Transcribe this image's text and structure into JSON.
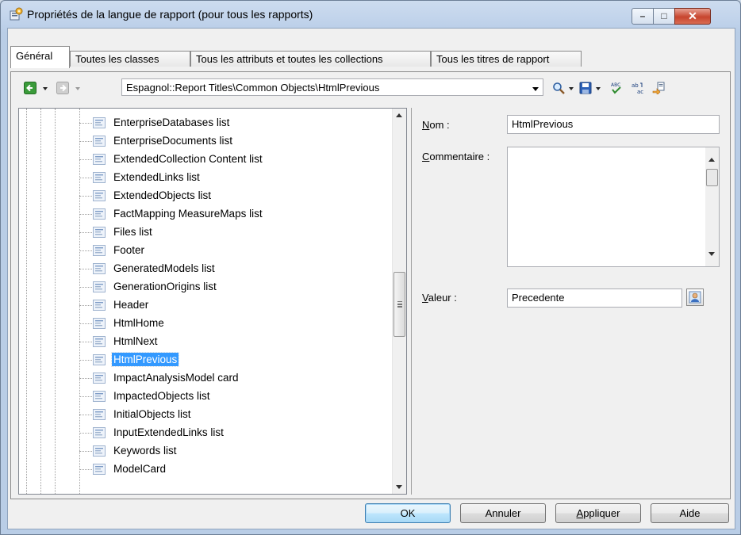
{
  "window": {
    "title": "Propriétés de la langue de rapport (pour tous les rapports)",
    "controls": {
      "minimize": "–",
      "maximize": "□",
      "close": "✕"
    }
  },
  "tabs": [
    {
      "label": "Général"
    },
    {
      "label": "Toutes les classes"
    },
    {
      "label": "Tous les attributs et toutes les collections"
    },
    {
      "label": "Tous les titres de rapport"
    }
  ],
  "toolbar": {
    "path": "Espagnol::Report Titles\\Common Objects\\HtmlPrevious",
    "icons": [
      "back-icon",
      "forward-icon",
      "find-icon",
      "save-icon",
      "spell-check-icon",
      "replace-icon",
      "export-icon"
    ]
  },
  "tree": {
    "items": [
      "EnterpriseDatabases list",
      "EnterpriseDocuments list",
      "ExtendedCollection Content list",
      "ExtendedLinks list",
      "ExtendedObjects list",
      "FactMapping MeasureMaps list",
      "Files list",
      "Footer",
      "GeneratedModels list",
      "GenerationOrigins list",
      "Header",
      "HtmlHome",
      "HtmlNext",
      "HtmlPrevious",
      "ImpactAnalysisModel card",
      "ImpactedObjects list",
      "InitialObjects list",
      "InputExtendedLinks list",
      "Keywords list",
      "ModelCard"
    ],
    "selected_index": 13
  },
  "form": {
    "nom_label_first": "N",
    "nom_label_rest": "om :",
    "nom_value": "HtmlPrevious",
    "commentaire_label_first": "C",
    "commentaire_label_rest": "ommentaire :",
    "commentaire_value": "",
    "valeur_label_first": "V",
    "valeur_label_rest": "aleur :",
    "valeur_value": "Precedente"
  },
  "buttons": {
    "ok": "OK",
    "annuler": "Annuler",
    "appliquer_first": "A",
    "appliquer_rest": "ppliquer",
    "aide": "Aide"
  },
  "colors": {
    "selection": "#3399ff",
    "close_button": "#c7452e",
    "title_bar": "#bed1ea"
  }
}
